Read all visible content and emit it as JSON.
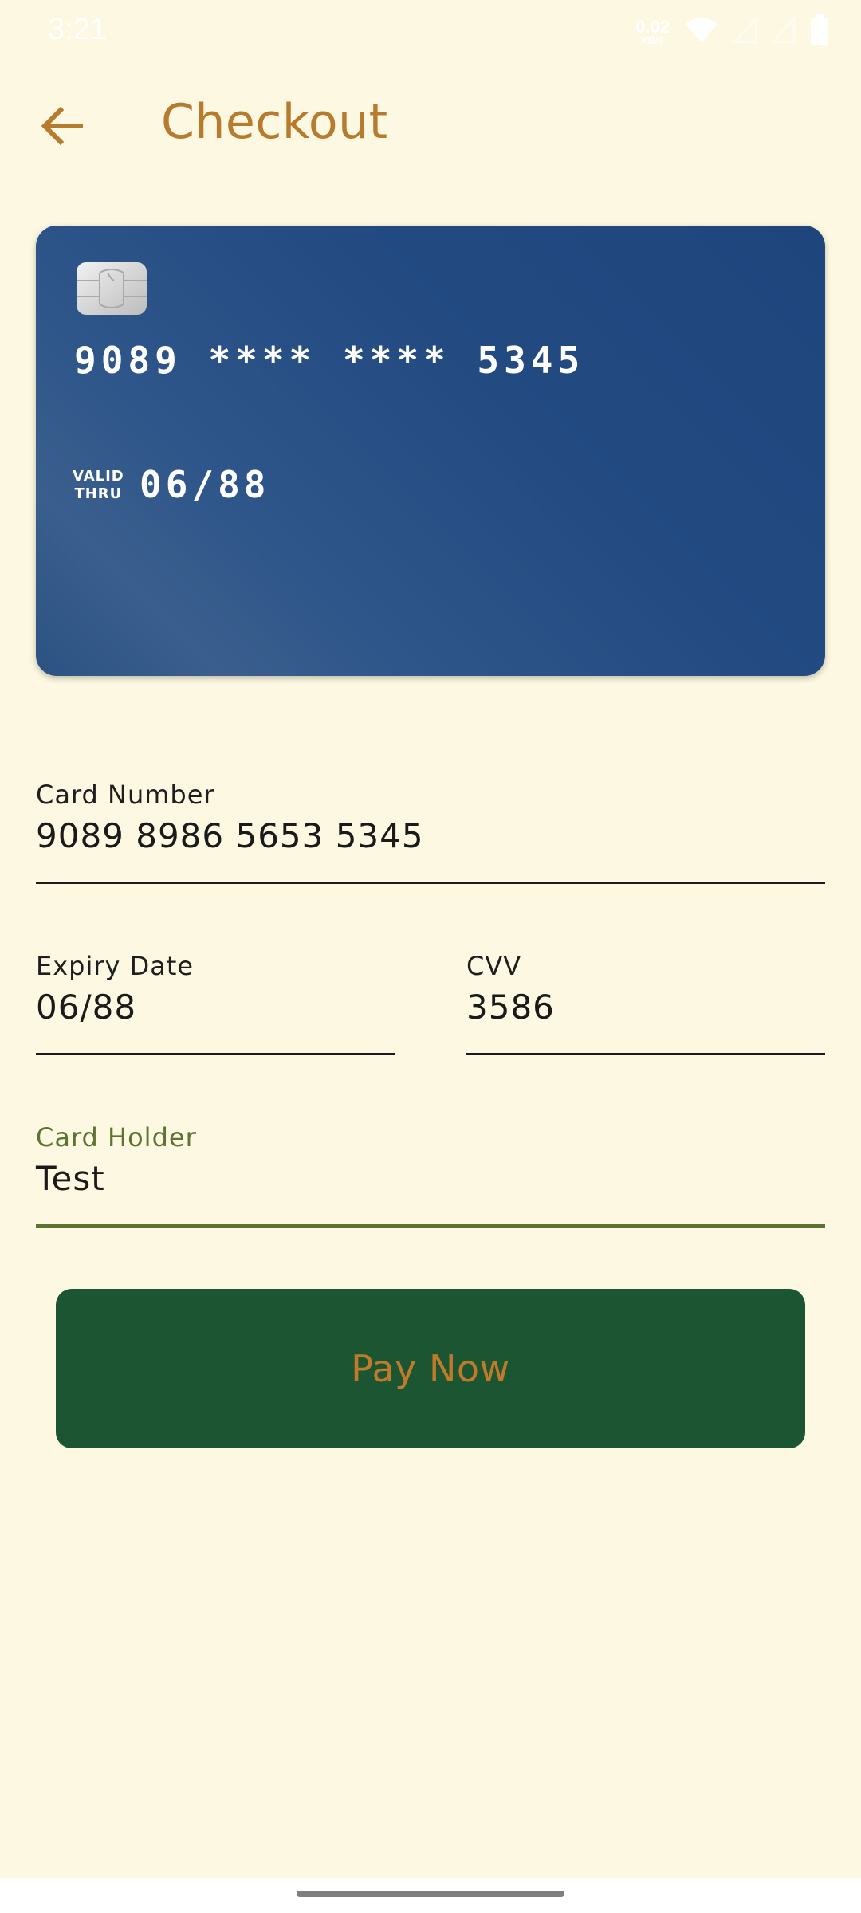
{
  "status_bar": {
    "time": "3:21",
    "net_speed_value": "0.02",
    "net_speed_unit": "KB/S",
    "icons": [
      "wifi-icon",
      "signal-icon",
      "signal-icon",
      "battery-icon"
    ]
  },
  "app_bar": {
    "back_icon": "arrow-left-icon",
    "title": "Checkout"
  },
  "card": {
    "number_masked": "9089 **** **** 5345",
    "valid_line1": "VALID",
    "valid_line2": "THRU",
    "expiry": "06/88",
    "chip_icon": "chip-icon"
  },
  "form": {
    "card_number": {
      "label": "Card Number",
      "value": "9089 8986 5653 5345"
    },
    "expiry": {
      "label": "Expiry Date",
      "value": "06/88"
    },
    "cvv": {
      "label": "CVV",
      "value": "3586"
    },
    "holder": {
      "label": "Card Holder",
      "value": "Test"
    }
  },
  "pay_button": {
    "label": "Pay Now"
  },
  "colors": {
    "background": "#fdf8e1",
    "accent": "#b87a2c",
    "card": "#1e457c",
    "button": "#1c5531",
    "focus": "#5c7332"
  }
}
